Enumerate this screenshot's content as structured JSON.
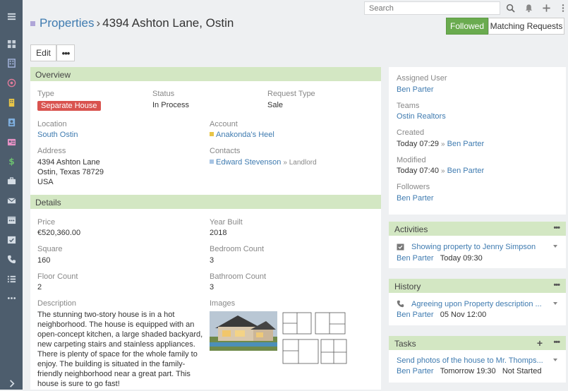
{
  "topbar": {
    "search_placeholder": "Search"
  },
  "breadcrumb": {
    "parent": "Properties",
    "separator": "›",
    "current": "4394 Ashton Lane, Ostin"
  },
  "actions": {
    "followed": "Followed",
    "matching_requests": "Matching Requests",
    "edit": "Edit",
    "more": "•••"
  },
  "overview": {
    "title": "Overview",
    "type_label": "Type",
    "type_value": "Separate House",
    "status_label": "Status",
    "status_value": "In Process",
    "request_type_label": "Request Type",
    "request_type_value": "Sale",
    "location_label": "Location",
    "location_value": "South Ostin",
    "account_label": "Account",
    "account_value": "Anakonda's Heel",
    "address_label": "Address",
    "address_line1": "4394 Ashton Lane",
    "address_line2": "Ostin, Texas 78729",
    "address_line3": "USA",
    "contacts_label": "Contacts",
    "contact_name": "Edward Stevenson",
    "contact_role": "» Landlord"
  },
  "details": {
    "title": "Details",
    "price_label": "Price",
    "price_value": "€520,360.00",
    "year_built_label": "Year Built",
    "year_built_value": "2018",
    "square_label": "Square",
    "square_value": "160",
    "bedroom_label": "Bedroom Count",
    "bedroom_value": "3",
    "floor_label": "Floor Count",
    "floor_value": "2",
    "bathroom_label": "Bathroom Count",
    "bathroom_value": "3",
    "description_label": "Description",
    "description": "The stunning two-story house is in a hot neighborhood. The house is equipped with an open-concept kitchen, a large shaded backyard, new carpeting stairs and stainless appliances. There is plenty of space for the whole family to enjoy. The building is situated in the family-friendly neighborhood near a great part. This house is sure to go fast!",
    "images_label": "Images"
  },
  "side": {
    "assigned_user_label": "Assigned User",
    "assigned_user": "Ben Parter",
    "teams_label": "Teams",
    "teams_value": "Ostin Realtors",
    "created_label": "Created",
    "created_time": "Today 07:29",
    "created_by": "Ben Parter",
    "modified_label": "Modified",
    "modified_time": "Today 07:40",
    "modified_by": "Ben Parter",
    "arrow": "»",
    "followers_label": "Followers",
    "followers_value": "Ben Parter"
  },
  "activities": {
    "title": "Activities",
    "item_title": "Showing property to Jenny Simpson",
    "item_user": "Ben Parter",
    "item_time": "Today 09:30"
  },
  "history": {
    "title": "History",
    "item_title": "Agreeing upon Property description ...",
    "item_user": "Ben Parter",
    "item_time": "05 Nov 12:00"
  },
  "tasks": {
    "title": "Tasks",
    "item_title": "Send photos of the house to Mr. Thomps...",
    "item_user": "Ben Parter",
    "item_time": "Tomorrow 19:30",
    "item_status": "Not Started"
  },
  "colors": {
    "accent_green": "#6aab4f",
    "panel_header": "#d3e7c3",
    "link": "#3f7bb0",
    "badge_red": "#d9534f",
    "sidebar": "#4d5d6d"
  }
}
